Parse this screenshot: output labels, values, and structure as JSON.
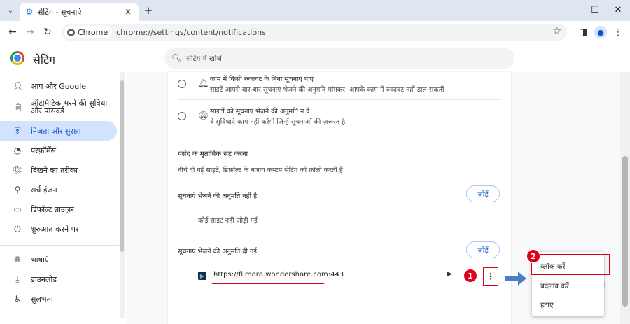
{
  "browser": {
    "tab_title": "सेटिंग - सूचनाएं",
    "new_tab": "+",
    "window_controls": {
      "minimize": "—",
      "maximize": "☐",
      "close": "✕"
    },
    "chip_label": "Chrome",
    "url": "chrome://settings/content/notifications"
  },
  "settings": {
    "title": "सेटिंग",
    "search_placeholder": "सेटिंग में खोजें"
  },
  "sidebar": {
    "items": [
      {
        "label": "आप और Google",
        "icon": "person-icon"
      },
      {
        "label": "ऑटोमैटिक भरने की सुविधा और पासवर्ड",
        "icon": "clipboard-icon"
      },
      {
        "label": "निजता और सुरक्षा",
        "icon": "shield-icon",
        "active": true
      },
      {
        "label": "परफ़ॉर्मेंस",
        "icon": "speedometer-icon"
      },
      {
        "label": "दिखने का तरीका",
        "icon": "palette-icon"
      },
      {
        "label": "सर्च इंजन",
        "icon": "search-icon"
      },
      {
        "label": "डिफ़ॉल्ट ब्राउज़र",
        "icon": "browser-icon"
      },
      {
        "label": "शुरुआत करने पर",
        "icon": "power-icon"
      },
      {
        "label": "भाषाएं",
        "icon": "globe-icon"
      },
      {
        "label": "डाउनलोड",
        "icon": "download-icon"
      },
      {
        "label": "सुलभता",
        "icon": "accessibility-icon"
      }
    ]
  },
  "main": {
    "option_quiet": {
      "title": "काम में किसी रुकावट के बिना सूचनाएं पाएं",
      "desc": "साइटें आपसे बार-बार सूचनाएं भेजने की अनुमति मांगकर, आपके काम में रुकावट नहीं डाल सकतीं"
    },
    "option_block": {
      "title": "साइटों को सूचनाएं भेजने की अनुमति न दें",
      "desc": "वे सुविधाएं काम नहीं करेंगी जिन्हें सूचनाओं की ज़रूरत है"
    },
    "custom_heading": "पसंद के मुताबिक सेट करना",
    "custom_desc": "नीचे दी गई साइटें, डिफ़ॉल्ट के बजाय कस्टम सेटिंग को फ़ॉलो करती हैं",
    "not_allowed_label": "सूचनाएं भेजने की अनुमति नहीं है",
    "add_label": "जोड़ें",
    "no_sites": "कोई साइट नहीं जोड़ी गई",
    "allowed_label": "सूचनाएं भेजने की अनुमति दी गई",
    "allowed_site": "https://filmora.wondershare.com:443"
  },
  "popup_menu": {
    "items": [
      "ब्लॉक करें",
      "बदलाव करें",
      "हटाएं"
    ]
  },
  "annotations": {
    "badge_1": "1",
    "badge_2": "2",
    "highlight_color": "#e0001b",
    "arrow_color": "#4a7fc1"
  }
}
